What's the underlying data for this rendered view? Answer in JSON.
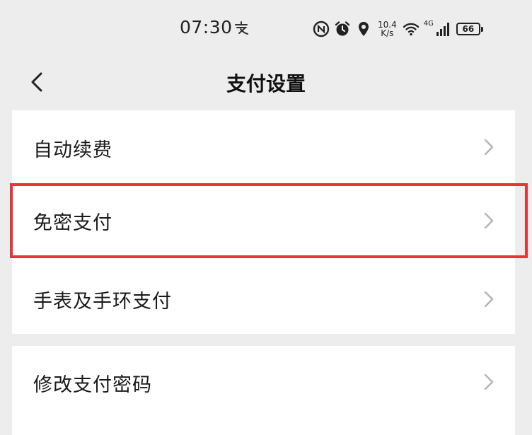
{
  "status_bar": {
    "time": "07:30",
    "app_icon": "alipay-notification-icon",
    "icons": [
      "nfc-icon",
      "alarm-icon",
      "location-icon"
    ],
    "net_speed_value": "10.4",
    "net_speed_unit": "K/s",
    "wifi_icon": "wifi-icon",
    "network_type": "4G",
    "signal_icon": "signal-icon",
    "battery_level": "66"
  },
  "header": {
    "back_icon": "chevron-left-icon",
    "title": "支付设置"
  },
  "settings": {
    "group1": [
      {
        "label": "自动续费"
      },
      {
        "label": "免密支付"
      },
      {
        "label": "手表及手环支付"
      }
    ],
    "group2": [
      {
        "label": "修改支付密码"
      }
    ]
  },
  "highlight": {
    "target": "免密支付",
    "color": "#e8333a"
  },
  "colors": {
    "background": "#ededed",
    "card": "#ffffff",
    "chevron": "#b3b3b3"
  }
}
